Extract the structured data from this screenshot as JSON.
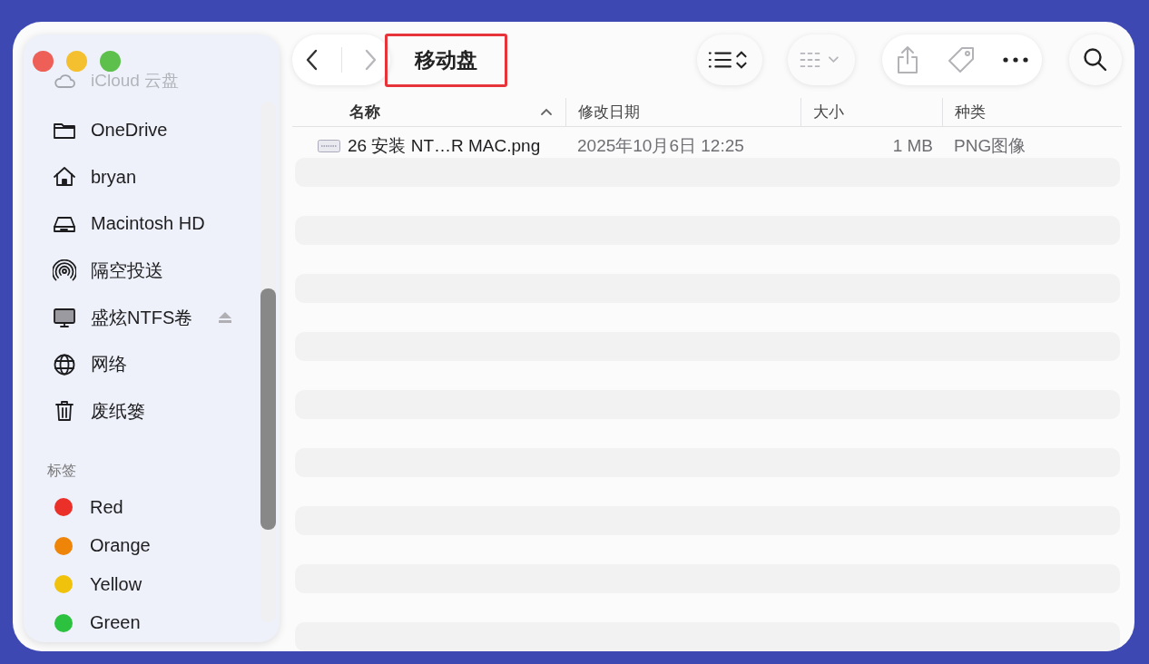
{
  "sidebar": {
    "faded_item": {
      "label": "iCloud 云盘",
      "kind": "cloud"
    },
    "items": [
      {
        "label": "OneDrive",
        "kind": "folder",
        "eject": false
      },
      {
        "label": "bryan",
        "kind": "home",
        "eject": false
      },
      {
        "label": "Macintosh HD",
        "kind": "disk",
        "eject": false
      },
      {
        "label": "隔空投送",
        "kind": "airdrop",
        "eject": false
      },
      {
        "label": "盛炫NTFS卷",
        "kind": "display",
        "eject": true
      },
      {
        "label": "网络",
        "kind": "globe",
        "eject": false
      },
      {
        "label": "废纸篓",
        "kind": "trash",
        "eject": false
      }
    ],
    "tags_heading": "标签",
    "tags": [
      {
        "label": "Red",
        "color": "#ea3029"
      },
      {
        "label": "Orange",
        "color": "#ee8408"
      },
      {
        "label": "Yellow",
        "color": "#f0c20c"
      },
      {
        "label": "Green",
        "color": "#2cc13f"
      }
    ]
  },
  "toolbar": {
    "back": {
      "disabled": false
    },
    "forward": {
      "disabled": true
    },
    "title": "移动盘",
    "title_highlighted": true
  },
  "table": {
    "columns": [
      {
        "label": "名称",
        "sorted": true
      },
      {
        "label": "修改日期",
        "sorted": false
      },
      {
        "label": "大小",
        "sorted": false
      },
      {
        "label": "种类",
        "sorted": false
      }
    ],
    "rows": [
      {
        "name": "26 安装 NT…R MAC.png",
        "date": "2025年10月6日 12:25",
        "size": "1 MB",
        "kind": "PNG图像"
      }
    ]
  }
}
